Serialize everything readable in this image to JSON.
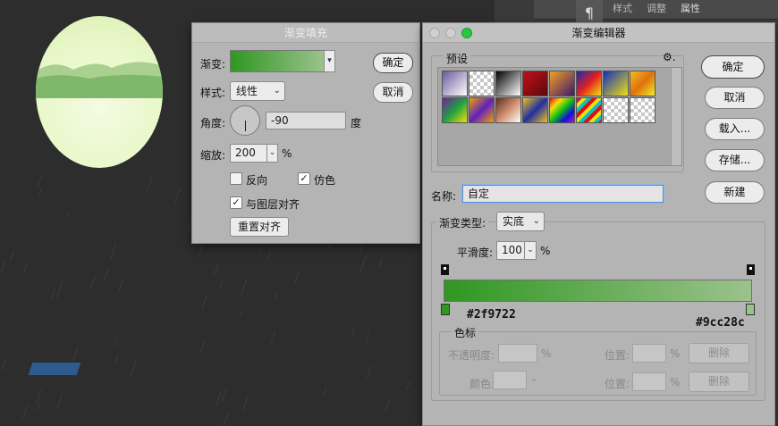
{
  "background": {
    "right_tabs": [
      "样式",
      "调整",
      "属性"
    ]
  },
  "fill_dialog": {
    "title": "渐变填充",
    "gradient_label": "渐变:",
    "style_label": "样式:",
    "style_value": "线性",
    "angle_label": "角度:",
    "angle_value": "-90",
    "angle_unit": "度",
    "scale_label": "缩放:",
    "scale_value": "200",
    "scale_unit": "%",
    "reverse_label": "反向",
    "reverse_checked": false,
    "dither_label": "仿色",
    "dither_checked": true,
    "align_label": "与图层对齐",
    "align_checked": true,
    "reset_align_label": "重置对齐",
    "ok_label": "确定",
    "cancel_label": "取消"
  },
  "editor_dialog": {
    "title": "渐变编辑器",
    "presets_label": "预设",
    "ok_label": "确定",
    "cancel_label": "取消",
    "load_label": "载入...",
    "save_label": "存储...",
    "name_label": "名称:",
    "name_value": "自定",
    "new_label": "新建",
    "type_label": "渐变类型:",
    "type_value": "实底",
    "smooth_label": "平滑度:",
    "smooth_value": "100",
    "smooth_unit": "%",
    "stop_left_color": "#2f9722",
    "stop_right_color": "#9cc28c",
    "stops_group_label": "色标",
    "opacity_label": "不透明度:",
    "opacity_unit": "%",
    "location_label": "位置:",
    "location_unit": "%",
    "delete_label": "删除",
    "color_label": "颜色:",
    "location_label_2": "位置:",
    "location_unit_2": "%",
    "delete_label_2": "删除"
  },
  "colors": {
    "gradient_start": "#2f9722",
    "gradient_end": "#9cc28c",
    "traffic_green": "#28c840"
  }
}
